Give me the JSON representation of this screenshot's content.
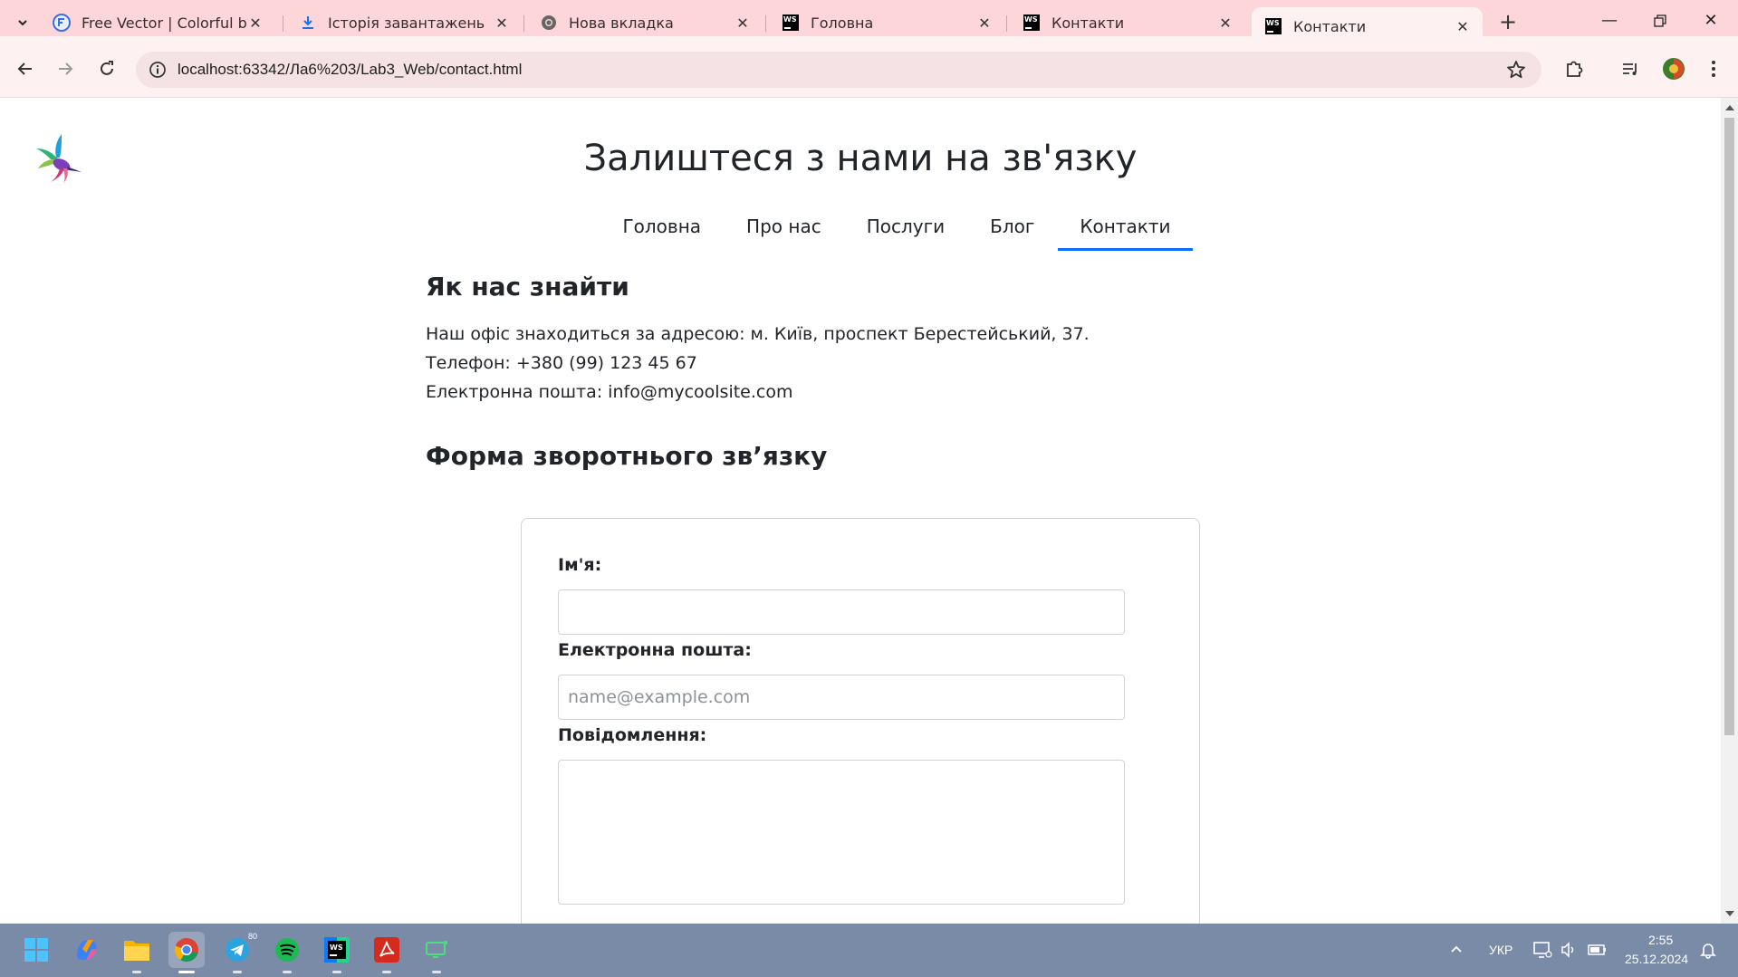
{
  "browser": {
    "tabs": [
      {
        "title": "Free Vector | Colorful bird",
        "icon": "freepik-icon"
      },
      {
        "title": "Історія завантажень",
        "icon": "download-icon"
      },
      {
        "title": "Нова вкладка",
        "icon": "chrome-icon"
      },
      {
        "title": "Головна",
        "icon": "webstorm-icon"
      },
      {
        "title": "Контакти",
        "icon": "webstorm-icon"
      },
      {
        "title": "Контакти",
        "icon": "webstorm-icon",
        "active": true
      }
    ],
    "url": "localhost:63342/Ла6%203/Lab3_Web/contact.html"
  },
  "page": {
    "title": "Залиштеся з нами на зв'язку",
    "nav": [
      "Головна",
      "Про нас",
      "Послуги",
      "Блог",
      "Контакти"
    ],
    "active_nav": "Контакти",
    "find_us": {
      "heading": "Як нас знайти",
      "address": "Наш офіс знаходиться за адресою: м. Київ, проспект Берестейський, 37.",
      "phone": "Телефон: +380 (99) 123 45 67",
      "email": "Електронна пошта: info@mycoolsite.com"
    },
    "form": {
      "heading": "Форма зворотнього зв’язку",
      "name_label": "Ім'я:",
      "name_value": "",
      "email_label": "Електронна пошта:",
      "email_placeholder": "name@example.com",
      "message_label": "Повідомлення:",
      "message_value": ""
    }
  },
  "taskbar": {
    "apps": [
      "start-icon",
      "copilot-icon",
      "file-explorer-icon",
      "chrome-icon",
      "telegram-icon",
      "spotify-icon",
      "webstorm-icon",
      "acrobat-icon",
      "screen-app-icon"
    ],
    "telegram_badge": "80",
    "language": "УКР",
    "time": "2:55",
    "date": "25.12.2024"
  },
  "colors": {
    "tabstrip": "#fcd6d8",
    "toolbar": "#fdf1f2",
    "accent": "#0d6efd",
    "taskbar": "#7a8ba8"
  }
}
